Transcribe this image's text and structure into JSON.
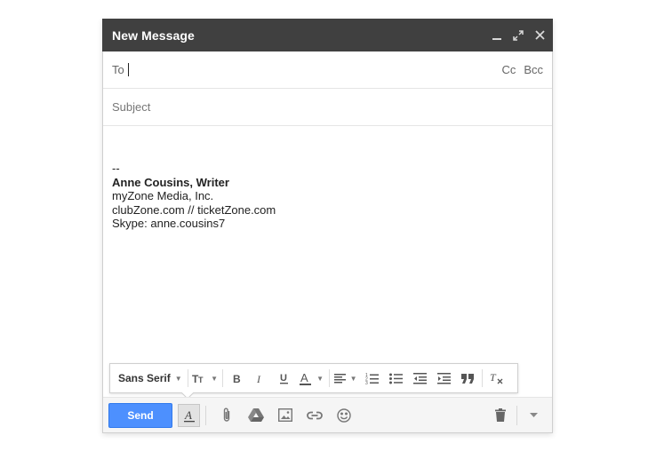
{
  "window": {
    "title": "New Message"
  },
  "fields": {
    "to_label": "To",
    "cc_label": "Cc",
    "bcc_label": "Bcc",
    "subject_placeholder": "Subject"
  },
  "body": {
    "sig_sep": "--",
    "name": "Anne Cousins, Writer",
    "company": "myZone Media, Inc.",
    "sites": "clubZone.com // ticketZone.com",
    "skype": "Skype: anne.cousins7"
  },
  "format_toolbar": {
    "font": "Sans Serif"
  },
  "actions": {
    "send_label": "Send"
  },
  "colors": {
    "titlebar": "#404040",
    "send": "#4d90fe"
  }
}
